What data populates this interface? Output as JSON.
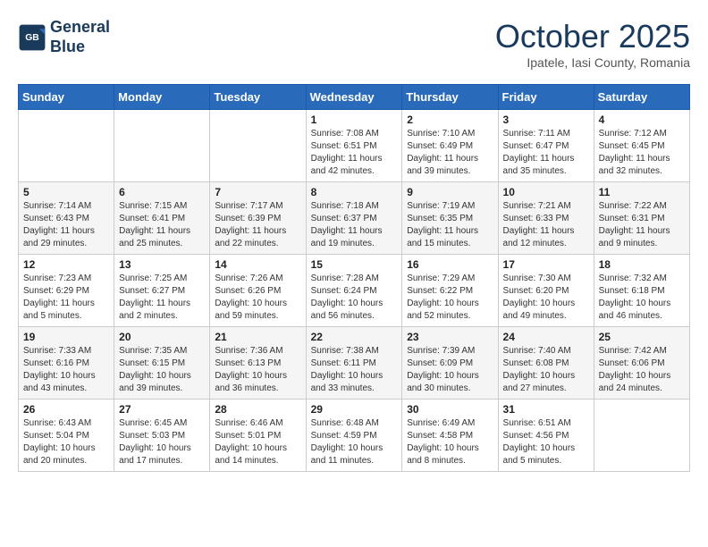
{
  "header": {
    "logo_line1": "General",
    "logo_line2": "Blue",
    "month": "October 2025",
    "location": "Ipatele, Iasi County, Romania"
  },
  "weekdays": [
    "Sunday",
    "Monday",
    "Tuesday",
    "Wednesday",
    "Thursday",
    "Friday",
    "Saturday"
  ],
  "weeks": [
    [
      {
        "day": "",
        "info": ""
      },
      {
        "day": "",
        "info": ""
      },
      {
        "day": "",
        "info": ""
      },
      {
        "day": "1",
        "info": "Sunrise: 7:08 AM\nSunset: 6:51 PM\nDaylight: 11 hours\nand 42 minutes."
      },
      {
        "day": "2",
        "info": "Sunrise: 7:10 AM\nSunset: 6:49 PM\nDaylight: 11 hours\nand 39 minutes."
      },
      {
        "day": "3",
        "info": "Sunrise: 7:11 AM\nSunset: 6:47 PM\nDaylight: 11 hours\nand 35 minutes."
      },
      {
        "day": "4",
        "info": "Sunrise: 7:12 AM\nSunset: 6:45 PM\nDaylight: 11 hours\nand 32 minutes."
      }
    ],
    [
      {
        "day": "5",
        "info": "Sunrise: 7:14 AM\nSunset: 6:43 PM\nDaylight: 11 hours\nand 29 minutes."
      },
      {
        "day": "6",
        "info": "Sunrise: 7:15 AM\nSunset: 6:41 PM\nDaylight: 11 hours\nand 25 minutes."
      },
      {
        "day": "7",
        "info": "Sunrise: 7:17 AM\nSunset: 6:39 PM\nDaylight: 11 hours\nand 22 minutes."
      },
      {
        "day": "8",
        "info": "Sunrise: 7:18 AM\nSunset: 6:37 PM\nDaylight: 11 hours\nand 19 minutes."
      },
      {
        "day": "9",
        "info": "Sunrise: 7:19 AM\nSunset: 6:35 PM\nDaylight: 11 hours\nand 15 minutes."
      },
      {
        "day": "10",
        "info": "Sunrise: 7:21 AM\nSunset: 6:33 PM\nDaylight: 11 hours\nand 12 minutes."
      },
      {
        "day": "11",
        "info": "Sunrise: 7:22 AM\nSunset: 6:31 PM\nDaylight: 11 hours\nand 9 minutes."
      }
    ],
    [
      {
        "day": "12",
        "info": "Sunrise: 7:23 AM\nSunset: 6:29 PM\nDaylight: 11 hours\nand 5 minutes."
      },
      {
        "day": "13",
        "info": "Sunrise: 7:25 AM\nSunset: 6:27 PM\nDaylight: 11 hours\nand 2 minutes."
      },
      {
        "day": "14",
        "info": "Sunrise: 7:26 AM\nSunset: 6:26 PM\nDaylight: 10 hours\nand 59 minutes."
      },
      {
        "day": "15",
        "info": "Sunrise: 7:28 AM\nSunset: 6:24 PM\nDaylight: 10 hours\nand 56 minutes."
      },
      {
        "day": "16",
        "info": "Sunrise: 7:29 AM\nSunset: 6:22 PM\nDaylight: 10 hours\nand 52 minutes."
      },
      {
        "day": "17",
        "info": "Sunrise: 7:30 AM\nSunset: 6:20 PM\nDaylight: 10 hours\nand 49 minutes."
      },
      {
        "day": "18",
        "info": "Sunrise: 7:32 AM\nSunset: 6:18 PM\nDaylight: 10 hours\nand 46 minutes."
      }
    ],
    [
      {
        "day": "19",
        "info": "Sunrise: 7:33 AM\nSunset: 6:16 PM\nDaylight: 10 hours\nand 43 minutes."
      },
      {
        "day": "20",
        "info": "Sunrise: 7:35 AM\nSunset: 6:15 PM\nDaylight: 10 hours\nand 39 minutes."
      },
      {
        "day": "21",
        "info": "Sunrise: 7:36 AM\nSunset: 6:13 PM\nDaylight: 10 hours\nand 36 minutes."
      },
      {
        "day": "22",
        "info": "Sunrise: 7:38 AM\nSunset: 6:11 PM\nDaylight: 10 hours\nand 33 minutes."
      },
      {
        "day": "23",
        "info": "Sunrise: 7:39 AM\nSunset: 6:09 PM\nDaylight: 10 hours\nand 30 minutes."
      },
      {
        "day": "24",
        "info": "Sunrise: 7:40 AM\nSunset: 6:08 PM\nDaylight: 10 hours\nand 27 minutes."
      },
      {
        "day": "25",
        "info": "Sunrise: 7:42 AM\nSunset: 6:06 PM\nDaylight: 10 hours\nand 24 minutes."
      }
    ],
    [
      {
        "day": "26",
        "info": "Sunrise: 6:43 AM\nSunset: 5:04 PM\nDaylight: 10 hours\nand 20 minutes."
      },
      {
        "day": "27",
        "info": "Sunrise: 6:45 AM\nSunset: 5:03 PM\nDaylight: 10 hours\nand 17 minutes."
      },
      {
        "day": "28",
        "info": "Sunrise: 6:46 AM\nSunset: 5:01 PM\nDaylight: 10 hours\nand 14 minutes."
      },
      {
        "day": "29",
        "info": "Sunrise: 6:48 AM\nSunset: 4:59 PM\nDaylight: 10 hours\nand 11 minutes."
      },
      {
        "day": "30",
        "info": "Sunrise: 6:49 AM\nSunset: 4:58 PM\nDaylight: 10 hours\nand 8 minutes."
      },
      {
        "day": "31",
        "info": "Sunrise: 6:51 AM\nSunset: 4:56 PM\nDaylight: 10 hours\nand 5 minutes."
      },
      {
        "day": "",
        "info": ""
      }
    ]
  ]
}
